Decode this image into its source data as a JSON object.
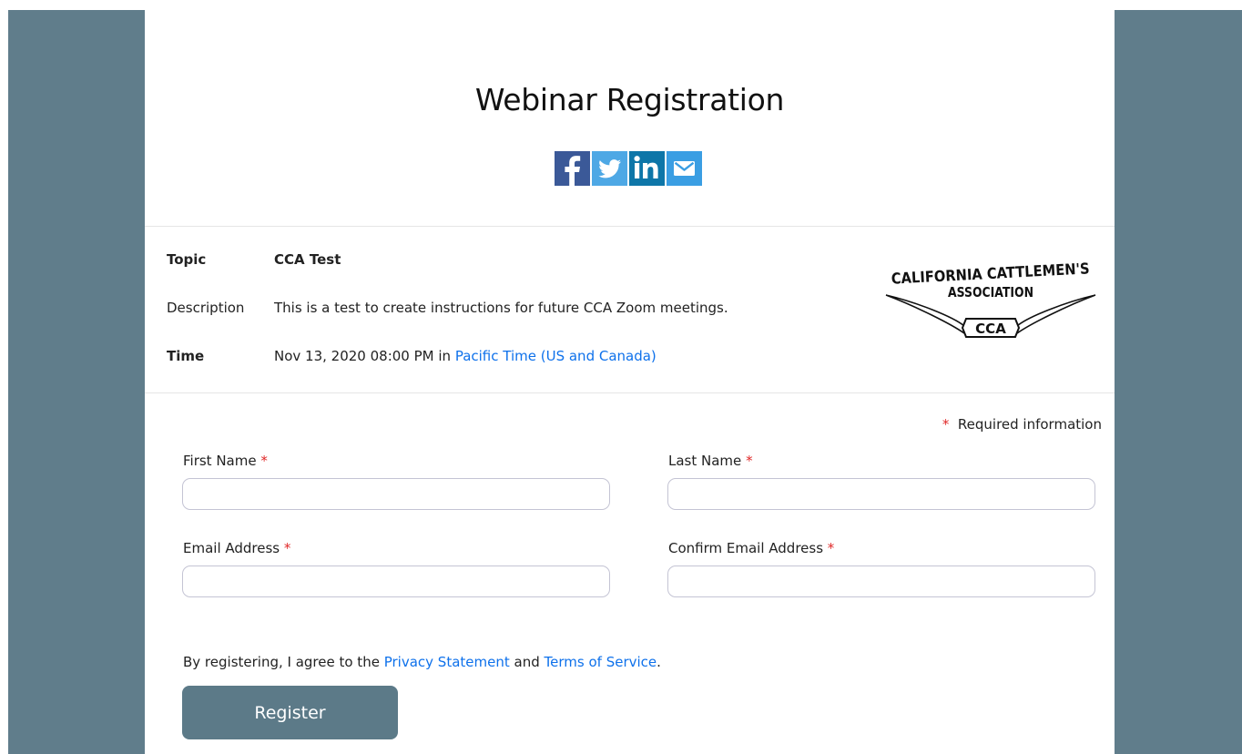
{
  "page": {
    "title": "Webinar Registration"
  },
  "share": {
    "items": [
      {
        "icon": "facebook-icon",
        "color": "#3b5998"
      },
      {
        "icon": "twitter-icon",
        "color": "#4ea8e5"
      },
      {
        "icon": "linkedin-icon",
        "color": "#0e76a8"
      },
      {
        "icon": "email-icon",
        "color": "#3a9ee3"
      }
    ]
  },
  "details": {
    "topic_label": "Topic",
    "topic_value": "CCA Test",
    "description_label": "Description",
    "description_value": "This is a test to create instructions for future CCA Zoom meetings.",
    "time_label": "Time",
    "time_value": "Nov 13, 2020 08:00 PM in",
    "timezone_link": "Pacific Time (US and Canada)"
  },
  "logo": {
    "line1": "CALIFORNIA CATTLEMEN'S",
    "line2": "ASSOCIATION",
    "badge": "CCA"
  },
  "form": {
    "required_marker": "*",
    "required_note": "Required information",
    "first_name_label": "First Name",
    "last_name_label": "Last Name",
    "email_label": "Email Address",
    "confirm_email_label": "Confirm Email Address",
    "first_name_value": "",
    "last_name_value": "",
    "email_value": "",
    "confirm_email_value": ""
  },
  "agreement": {
    "prefix": "By registering, I agree to the",
    "privacy_link": "Privacy Statement",
    "and": "and",
    "terms_link": "Terms of Service",
    "suffix": "."
  },
  "actions": {
    "register_label": "Register"
  },
  "colors": {
    "background": "#607d8b",
    "link": "#0e71eb",
    "required": "#e02828",
    "button": "#5c7a88"
  }
}
